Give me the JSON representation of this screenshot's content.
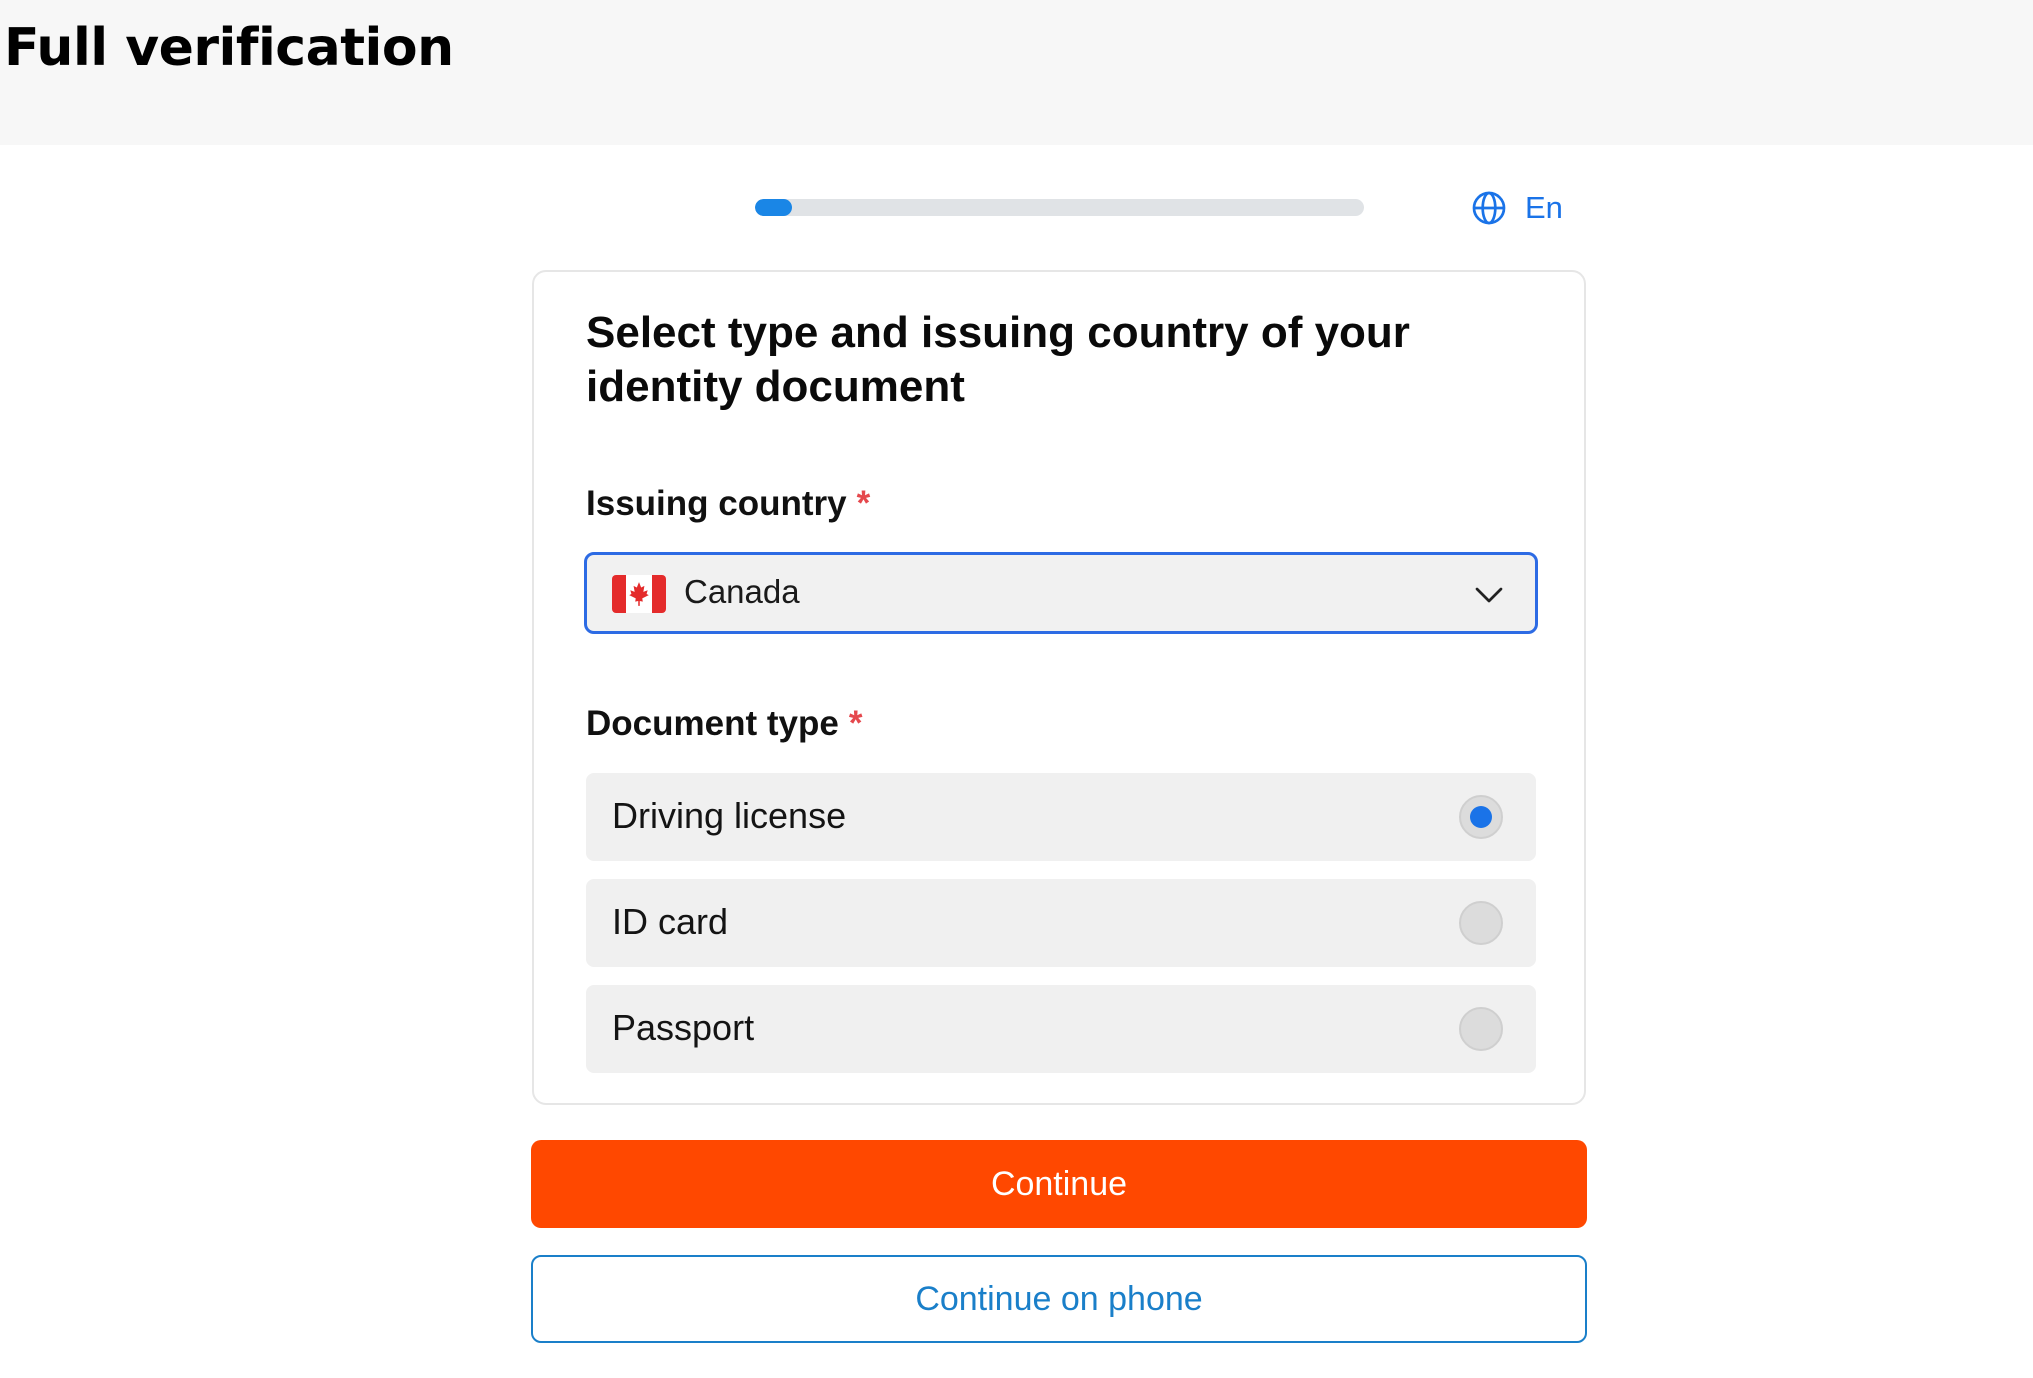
{
  "header": {
    "title": "Full verification"
  },
  "progress": {
    "fraction": 0.06,
    "color": "#1a86e6"
  },
  "language": {
    "label": "En",
    "icon": "globe-icon"
  },
  "card": {
    "title": "Select type and issuing country of your identity document",
    "country": {
      "label": "Issuing country",
      "required_mark": "*",
      "selected": "Canada",
      "flag_icon": "canada-flag-icon"
    },
    "document_type": {
      "label": "Document type",
      "required_mark": "*",
      "options": [
        {
          "label": "Driving license",
          "checked": true
        },
        {
          "label": "ID card",
          "checked": false
        },
        {
          "label": "Passport",
          "checked": false
        }
      ]
    }
  },
  "actions": {
    "continue_label": "Continue",
    "continue_phone_label": "Continue on phone",
    "primary_color": "#ff4800",
    "secondary_color": "#1a7fc9"
  }
}
